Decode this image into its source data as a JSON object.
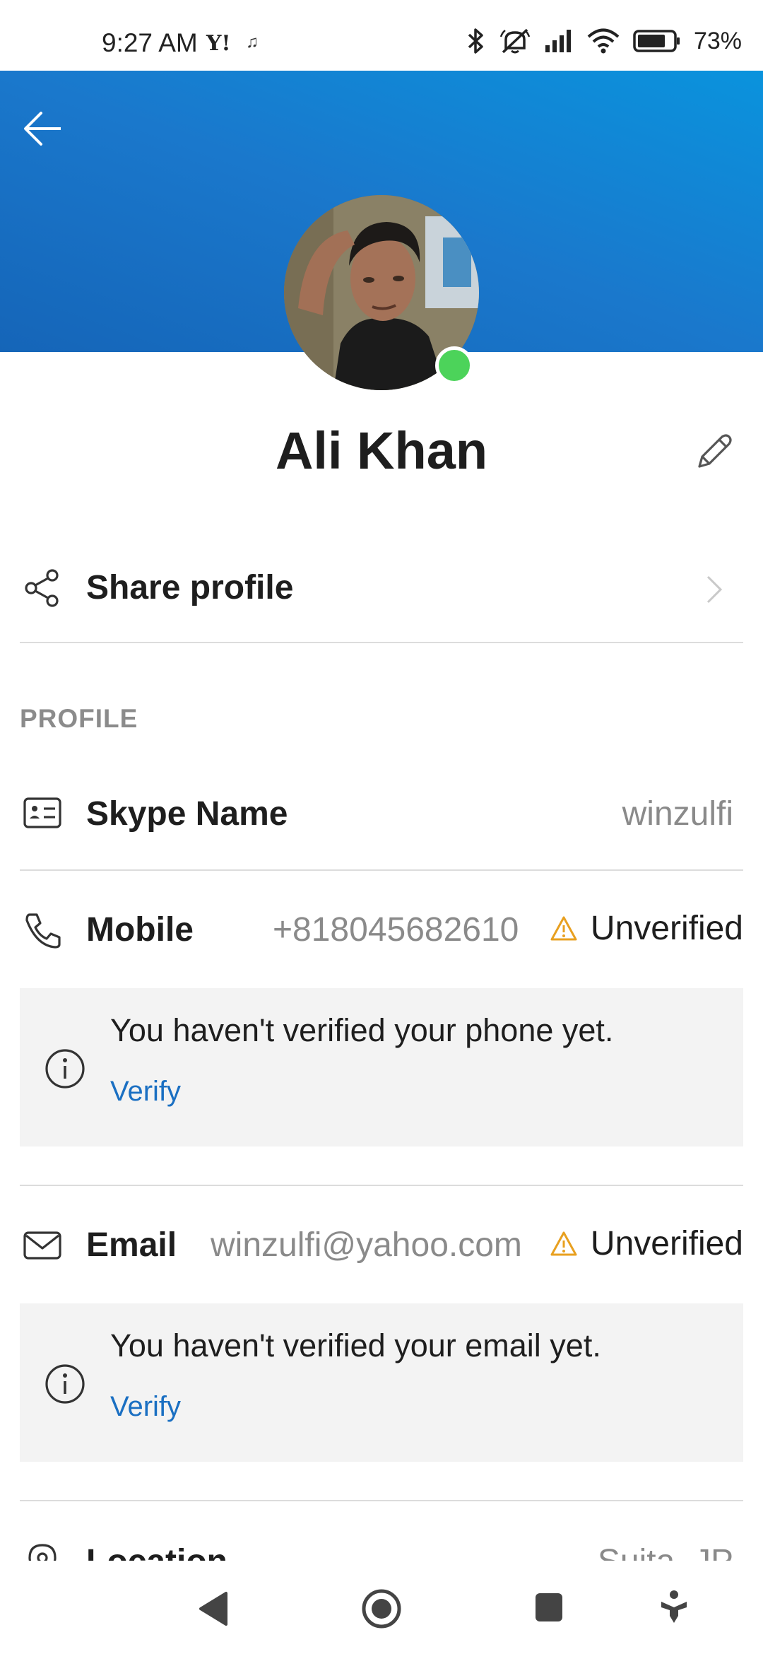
{
  "status_bar": {
    "time": "9:27 AM",
    "yahoo_glyph": "Y!",
    "battery_percent": "73%",
    "icons": [
      "music-note-icon",
      "bluetooth-icon",
      "mute-icon",
      "signal-icon",
      "wifi-icon",
      "battery-icon"
    ]
  },
  "header": {
    "back_icon": "arrow-left-icon",
    "gradient_colors": [
      "#1565b8",
      "#0a93dd"
    ]
  },
  "profile": {
    "name": "Ali Khan",
    "presence_color": "#4cd35a",
    "edit_icon": "pencil-icon"
  },
  "share": {
    "label": "Share profile",
    "icon": "share-icon"
  },
  "section": {
    "title": "PROFILE"
  },
  "rows": {
    "skype": {
      "label": "Skype Name",
      "value": "winzulfi",
      "icon": "id-card-icon"
    },
    "mobile": {
      "label": "Mobile",
      "value": "+818045682610",
      "status": "Unverified",
      "icon": "phone-icon",
      "notice": "You haven't verified your phone yet.",
      "action": "Verify"
    },
    "email": {
      "label": "Email",
      "value": "winzulfi@yahoo.com",
      "status": "Unverified",
      "icon": "mail-icon",
      "notice": "You haven't verified your email yet.",
      "action": "Verify"
    },
    "location": {
      "label": "Location",
      "value": "Suita, JP",
      "icon": "location-pin-icon"
    }
  },
  "colors": {
    "accent_link": "#1a6fc2",
    "warning": "#e8a020",
    "muted_text": "#8a8a8a"
  },
  "nav_bar": {
    "items": [
      "back-triangle-icon",
      "home-circle-icon",
      "recents-square-icon",
      "accessibility-icon"
    ]
  }
}
